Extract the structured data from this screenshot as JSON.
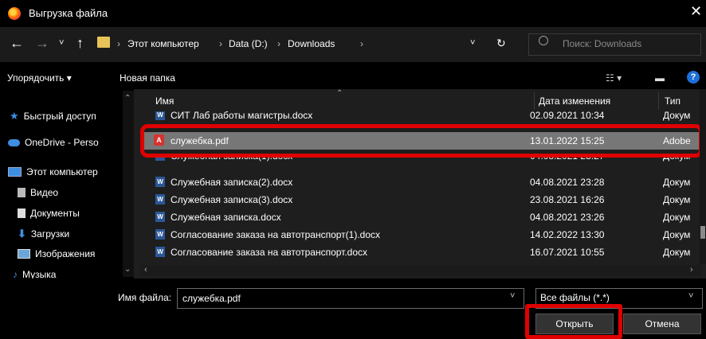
{
  "window": {
    "title": "Выгрузка файла",
    "close_glyph": "✕"
  },
  "nav": {
    "back_glyph": "←",
    "forward_glyph": "→",
    "dropdown_glyph": "˅",
    "up_glyph": "↑",
    "breadcrumb_sep": "›",
    "breadcrumbs": [
      "Этот компьютер",
      "Data (D:)",
      "Downloads"
    ],
    "refresh_glyph": "↻",
    "search_placeholder": "Поиск: Downloads"
  },
  "toolbar": {
    "organize_label": "Упорядочить ▾",
    "new_folder_label": "Новая папка",
    "view_glyph": "☷ ▾",
    "pane_glyph": "▬",
    "help_glyph": "?"
  },
  "sidebar": {
    "items": [
      {
        "label": "Быстрый доступ",
        "icon": "star-icon"
      },
      {
        "label": "OneDrive - Perso",
        "icon": "cloud-icon"
      },
      {
        "label": "Этот компьютер",
        "icon": "computer-icon"
      },
      {
        "label": "Видео",
        "icon": "video-icon"
      },
      {
        "label": "Документы",
        "icon": "documents-icon"
      },
      {
        "label": "Загрузки",
        "icon": "downloads-icon"
      },
      {
        "label": "Изображения",
        "icon": "images-icon"
      },
      {
        "label": "Музыка",
        "icon": "music-icon"
      }
    ]
  },
  "columns": {
    "name": "Имя",
    "date": "Дата изменения",
    "type": "Тип"
  },
  "files": [
    {
      "name": "СИТ Лаб работы магистры.docx",
      "date": "02.09.2021 10:34",
      "type": "Докум",
      "icon": "word-icon"
    },
    {
      "name": "служебка.pdf",
      "date": "13.01.2022 15:25",
      "type": "Adobe",
      "icon": "pdf-icon",
      "selected": true
    },
    {
      "name": "Служебная записка(1).docx",
      "date": "04.08.2021 23:27",
      "type": "Докум",
      "icon": "word-icon"
    },
    {
      "name": "Служебная записка(2).docx",
      "date": "04.08.2021 23:28",
      "type": "Докум",
      "icon": "word-icon"
    },
    {
      "name": "Служебная записка(3).docx",
      "date": "23.08.2021 16:26",
      "type": "Докум",
      "icon": "word-icon"
    },
    {
      "name": "Служебная записка.docx",
      "date": "04.08.2021 23:26",
      "type": "Докум",
      "icon": "word-icon"
    },
    {
      "name": "Согласование заказа на автотранспорт(1).docx",
      "date": "14.02.2022 13:30",
      "type": "Докум",
      "icon": "word-icon"
    },
    {
      "name": "Согласование заказа на автотранспорт.docx",
      "date": "16.07.2021 10:55",
      "type": "Докум",
      "icon": "word-icon"
    }
  ],
  "footer": {
    "filename_label": "Имя файла:",
    "filename_value": "служебка.pdf",
    "filetype_value": "Все файлы (*.*)",
    "open_label": "Открыть",
    "cancel_label": "Отмена"
  },
  "colors": {
    "highlight": "#e00000",
    "selected_row": "#777777",
    "word_icon": "#2b5797",
    "pdf_icon": "#d6322e"
  }
}
